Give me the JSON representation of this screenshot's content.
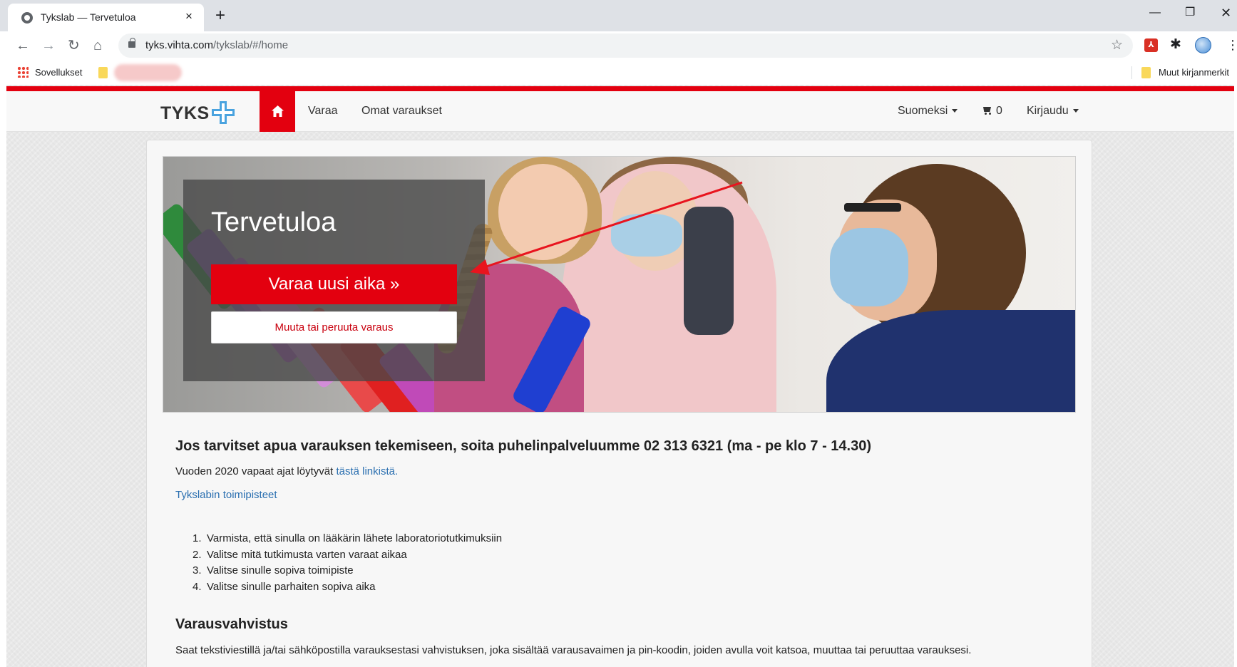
{
  "browser": {
    "tab_title": "Tykslab — Tervetuloa",
    "tab_close": "×",
    "new_tab": "+",
    "url_host": "tyks.vihta.com",
    "url_path": "/tykslab/#/home",
    "bookmarks": {
      "apps_label": "Sovellukset",
      "other_bookmarks": "Muut kirjanmerkit"
    }
  },
  "nav": {
    "logo_text": "TYKS",
    "links": {
      "book": "Varaa",
      "my_bookings": "Omat varaukset"
    },
    "language": "Suomeksi",
    "cart_count": "0",
    "login": "Kirjaudu"
  },
  "hero": {
    "title": "Tervetuloa",
    "book_button": "Varaa uusi aika »",
    "change_button": "Muuta tai peruuta varaus"
  },
  "content": {
    "help_heading": "Jos tarvitset apua varauksen tekemiseen, soita puhelinpalveluumme 02 313 6321 (ma - pe klo 7 - 14.30)",
    "free_slots_text": "Vuoden 2020 vapaat ajat löytyvät ",
    "free_slots_link": "tästä linkistä.",
    "locations_link": "Tykslabin toimipisteet",
    "steps": [
      {
        "num": "1.",
        "text": "Varmista, että sinulla on lääkärin lähete laboratoriotutkimuksiin"
      },
      {
        "num": "2.",
        "text": "Valitse mitä tutkimusta varten varaat aikaa"
      },
      {
        "num": "3.",
        "text": "Valitse sinulle sopiva toimipiste"
      },
      {
        "num": "4.",
        "text": "Valitse sinulle parhaiten sopiva aika"
      }
    ],
    "confirm_heading": "Varausvahvistus",
    "confirm_text": "Saat tekstiviestillä ja/tai sähköpostilla varauksestasi vahvistuksen, joka sisältää varausavaimen ja pin-koodin, joiden avulla voit katsoa, muuttaa tai peruuttaa varauksesi."
  },
  "colors": {
    "brand_red": "#e3000f",
    "link_blue": "#2a6fb0",
    "logo_blue": "#4aa3df"
  }
}
